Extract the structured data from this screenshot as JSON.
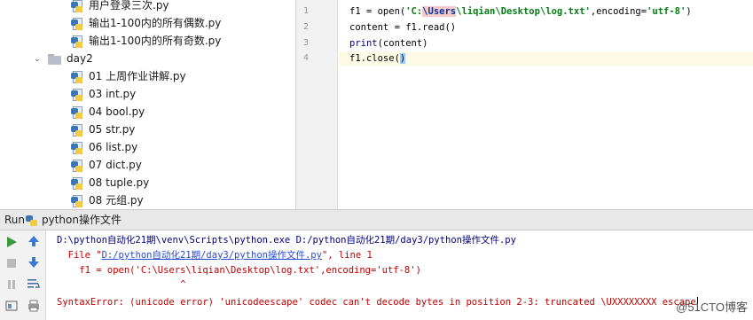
{
  "project_tree": {
    "top_files": [
      {
        "name": "用户登录三次.py"
      },
      {
        "name": "输出1-100内的所有偶数.py"
      },
      {
        "name": "输出1-100内的所有奇数.py"
      }
    ],
    "folder": {
      "name": "day2",
      "expanded": true
    },
    "folder_files": [
      {
        "name": "01 上周作业讲解.py"
      },
      {
        "name": "03 int.py"
      },
      {
        "name": "04 bool.py"
      },
      {
        "name": "05 str.py"
      },
      {
        "name": "06 list.py"
      },
      {
        "name": "07 dict.py"
      },
      {
        "name": "08 tuple.py"
      },
      {
        "name": "08 元组.py"
      }
    ]
  },
  "editor": {
    "line_numbers": [
      "1",
      "2",
      "3",
      "4"
    ],
    "lines": {
      "l1": {
        "var": "f1 = open(",
        "q1": "'C:",
        "escape": "\\Users",
        "path": "\\liqian\\Desktop\\log.txt'",
        "rest": ",encoding=",
        "enc": "'utf-8'",
        "close": ")"
      },
      "l2": {
        "text": "content = f1.read()"
      },
      "l3": {
        "kw": "print",
        "text": "(content)"
      },
      "l4": {
        "text": "f1.close(",
        "bracket": ")"
      }
    }
  },
  "run": {
    "label": "Run",
    "config_name": "python操作文件",
    "console": {
      "cmd": "D:\\python自动化21期\\venv\\Scripts\\python.exe D:/python自动化21期/day3/python操作文件.py",
      "file_prefix": "  File \"",
      "file_link": "D:/python自动化21期/day3/python操作文件.py",
      "file_suffix": "\", line 1",
      "code": "    f1 = open('C:\\Users\\liqian\\Desktop\\log.txt',encoding='utf-8')",
      "caret": "                      ^",
      "error": "SyntaxError: (unicode error) 'unicodeescape' codec can't decode bytes in position 2-3: truncated \\UXXXXXXXX escape"
    }
  },
  "watermark": "@51CTO博客",
  "colors": {
    "run_green": "#3b9a3b",
    "arrow_blue": "#3d7bd1",
    "error_red": "#c00000",
    "console_text": "#000080",
    "link": "#2a4bd6"
  }
}
